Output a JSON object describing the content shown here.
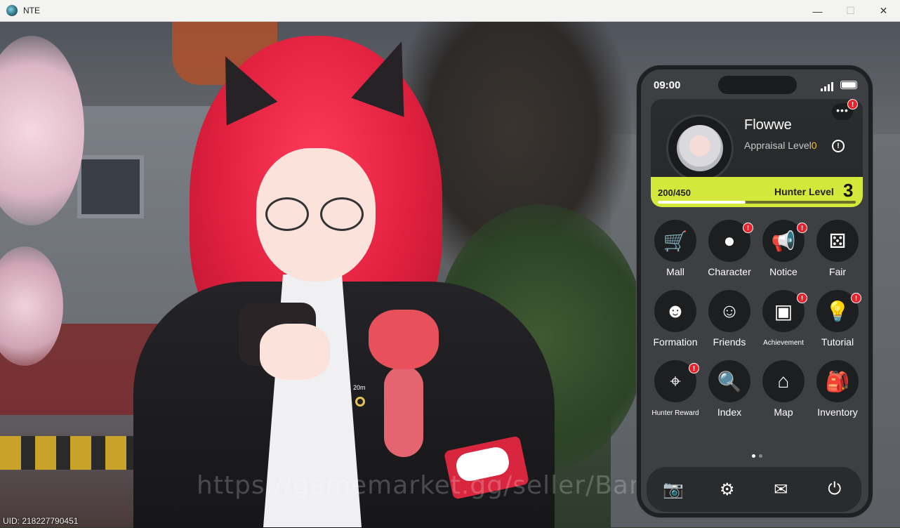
{
  "window": {
    "title": "NTE",
    "minimize": "—",
    "maximize": "☐",
    "close": "✕"
  },
  "game": {
    "distance_marker": "20m",
    "watermark": "https://gamemarket.gg/seller/BangJohn",
    "uid": "UID: 218227790451"
  },
  "phone": {
    "time": "09:00",
    "more_label": "•••",
    "alert_glyph": "!",
    "profile": {
      "username": "Flowwe",
      "appraisal_label": "Appraisal Level",
      "appraisal_level": "0",
      "info_glyph": "!",
      "xp_text": "200/450",
      "xp_progress": 0.444,
      "hunter_label": "Hunter Level",
      "hunter_level": "3"
    },
    "apps": [
      {
        "label": "Mall",
        "icon": "cart-icon",
        "glyph": "🛒",
        "alert": false
      },
      {
        "label": "Character",
        "icon": "character-icon",
        "glyph": "●",
        "alert": true
      },
      {
        "label": "Notice",
        "icon": "megaphone-icon",
        "glyph": "📢",
        "alert": true
      },
      {
        "label": "Fair",
        "icon": "dice-icon",
        "glyph": "⚄",
        "alert": false
      },
      {
        "label": "Formation",
        "icon": "formation-icon",
        "glyph": "☻",
        "alert": false
      },
      {
        "label": "Friends",
        "icon": "friends-icon",
        "glyph": "☺",
        "alert": false
      },
      {
        "label": "Achievement",
        "icon": "achievement-icon",
        "glyph": "▣",
        "alert": true,
        "small": true
      },
      {
        "label": "Tutorial",
        "icon": "lightbulb-icon",
        "glyph": "💡",
        "alert": true
      },
      {
        "label": "Hunter Reward",
        "icon": "crosshair-icon",
        "glyph": "⌖",
        "alert": true,
        "small": true
      },
      {
        "label": "Index",
        "icon": "index-icon",
        "glyph": "🔍",
        "alert": false
      },
      {
        "label": "Map",
        "icon": "map-pin-icon",
        "glyph": "⌂",
        "alert": false
      },
      {
        "label": "Inventory",
        "icon": "backpack-icon",
        "glyph": "🎒",
        "alert": false
      }
    ],
    "page_count": 2,
    "active_page": 1,
    "dock": [
      {
        "icon": "camera-icon",
        "glyph": "📷"
      },
      {
        "icon": "settings-gear-icon",
        "glyph": "⚙"
      },
      {
        "icon": "mail-icon",
        "glyph": "✉"
      },
      {
        "icon": "power-icon",
        "glyph": "⏻"
      }
    ]
  },
  "colors": {
    "hunter_bar": "#d3e83a",
    "alert_red": "#e8222c",
    "appraisal_yellow": "#ffc21a"
  }
}
